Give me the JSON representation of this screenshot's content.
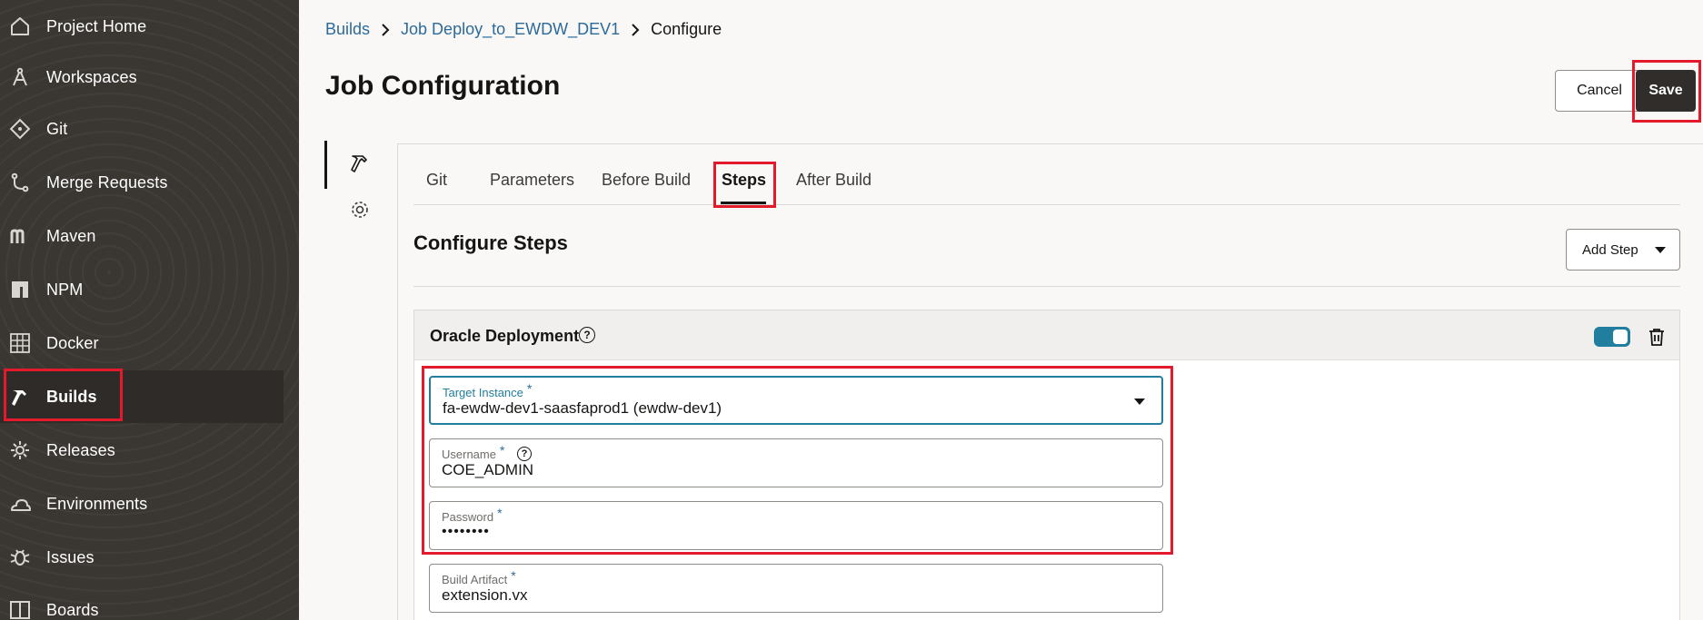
{
  "sidebar": {
    "items": [
      {
        "label": "Project Home",
        "icon": "home-icon"
      },
      {
        "label": "Workspaces",
        "icon": "compass-icon"
      },
      {
        "label": "Git",
        "icon": "git-icon"
      },
      {
        "label": "Merge Requests",
        "icon": "merge-request-icon"
      },
      {
        "label": "Maven",
        "icon": "maven-icon"
      },
      {
        "label": "NPM",
        "icon": "npm-icon"
      },
      {
        "label": "Docker",
        "icon": "docker-icon"
      },
      {
        "label": "Builds",
        "icon": "hammer-icon",
        "active": true
      },
      {
        "label": "Releases",
        "icon": "releases-gear-icon"
      },
      {
        "label": "Environments",
        "icon": "cloud-icon"
      },
      {
        "label": "Issues",
        "icon": "bug-icon"
      },
      {
        "label": "Boards",
        "icon": "board-icon"
      }
    ]
  },
  "breadcrumb": {
    "builds": "Builds",
    "job": "Job Deploy_to_EWDW_DEV1",
    "current": "Configure"
  },
  "page": {
    "title": "Job Configuration",
    "cancel_label": "Cancel",
    "save_label": "Save"
  },
  "tabs": [
    {
      "label": "Git"
    },
    {
      "label": "Parameters"
    },
    {
      "label": "Before Build"
    },
    {
      "label": "Steps",
      "active": true
    },
    {
      "label": "After Build"
    }
  ],
  "section": {
    "title": "Configure Steps",
    "add_step_label": "Add Step"
  },
  "step": {
    "title": "Oracle Deployment",
    "help": "?",
    "enabled": true,
    "fields": {
      "target_instance": {
        "label": "Target Instance",
        "required": "*",
        "value": "fa-ewdw-dev1-saasfaprod1 (ewdw-dev1)"
      },
      "username": {
        "label": "Username",
        "required": "*",
        "value": "COE_ADMIN"
      },
      "password": {
        "label": "Password",
        "required": "*",
        "value": "••••••••"
      },
      "build_artifact": {
        "label": "Build Artifact",
        "required": "*",
        "value": "extension.vx"
      }
    }
  },
  "colors": {
    "highlight": "#e3192c",
    "accent": "#227e9e",
    "link": "#2c6a9a",
    "sidebar_bg": "#3a3632"
  }
}
